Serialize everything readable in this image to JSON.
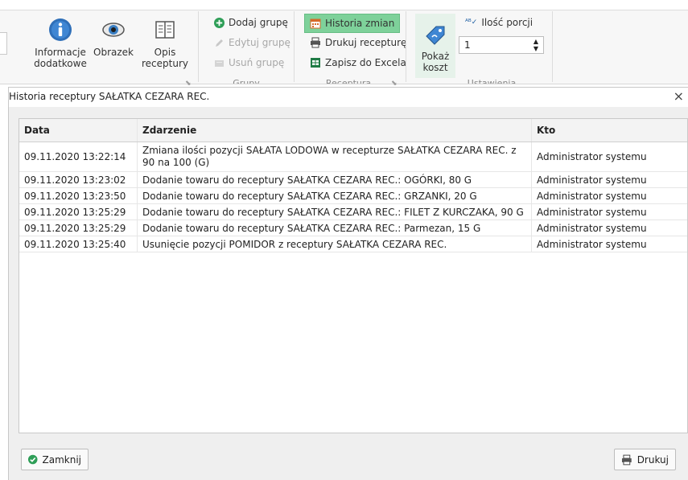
{
  "ribbon": {
    "left_buttons": [
      {
        "label_line1": "Informacje",
        "label_line2": "dodatkowe",
        "icon": "info-icon"
      },
      {
        "label_line1": "Obrazek",
        "label_line2": "",
        "icon": "eye-icon"
      },
      {
        "label_line1": "Opis",
        "label_line2": "receptury",
        "icon": "book-icon"
      }
    ],
    "groups": {
      "label": "Grupy",
      "items": [
        {
          "label": "Dodaj grupę",
          "icon": "plus-circle-icon",
          "enabled": true
        },
        {
          "label": "Edytuj grupę",
          "icon": "pencil-icon",
          "enabled": false
        },
        {
          "label": "Usuń grupę",
          "icon": "delete-group-icon",
          "enabled": false
        }
      ]
    },
    "recipe": {
      "label": "Receptura",
      "items": [
        {
          "label": "Historia zmian",
          "icon": "calendar-icon",
          "active": true
        },
        {
          "label": "Drukuj recepturę",
          "icon": "printer-icon",
          "active": false
        },
        {
          "label": "Zapisz do Excela",
          "icon": "excel-icon",
          "active": false
        }
      ]
    },
    "settings": {
      "label": "Ustawienia",
      "show_cost_line1": "Pokaż",
      "show_cost_line2": "koszt",
      "portions_label": "Ilość porcji",
      "portions_value": "1"
    },
    "accent_color": "#7ed19a"
  },
  "dialog": {
    "title": "Historia receptury SAŁATKA CEZARA REC.",
    "close_glyph": "×",
    "columns": [
      "Data",
      "Zdarzenie",
      "Kto"
    ],
    "rows": [
      {
        "date": "09.11.2020 13:22:14",
        "event": "Zmiana ilości pozycji SAŁATA LODOWA w recepturze SAŁATKA CEZARA REC. z 90 na 100 (G)",
        "who": "Administrator systemu"
      },
      {
        "date": "09.11.2020 13:23:02",
        "event": "Dodanie towaru do receptury SAŁATKA CEZARA REC.: OGÓRKI, 80 G",
        "who": "Administrator systemu"
      },
      {
        "date": "09.11.2020 13:23:50",
        "event": "Dodanie towaru do receptury SAŁATKA CEZARA REC.: GRZANKI, 20 G",
        "who": "Administrator systemu"
      },
      {
        "date": "09.11.2020 13:25:29",
        "event": "Dodanie towaru do receptury SAŁATKA CEZARA REC.: FILET Z KURCZAKA, 90 G",
        "who": "Administrator systemu"
      },
      {
        "date": "09.11.2020 13:25:29",
        "event": "Dodanie towaru do receptury SAŁATKA CEZARA REC.: Parmezan, 15 G",
        "who": "Administrator systemu"
      },
      {
        "date": "09.11.2020 13:25:40",
        "event": "Usunięcie pozycji POMIDOR z receptury SAŁATKA CEZARA REC.",
        "who": "Administrator systemu"
      }
    ],
    "close_button": "Zamknij",
    "print_button": "Drukuj"
  }
}
